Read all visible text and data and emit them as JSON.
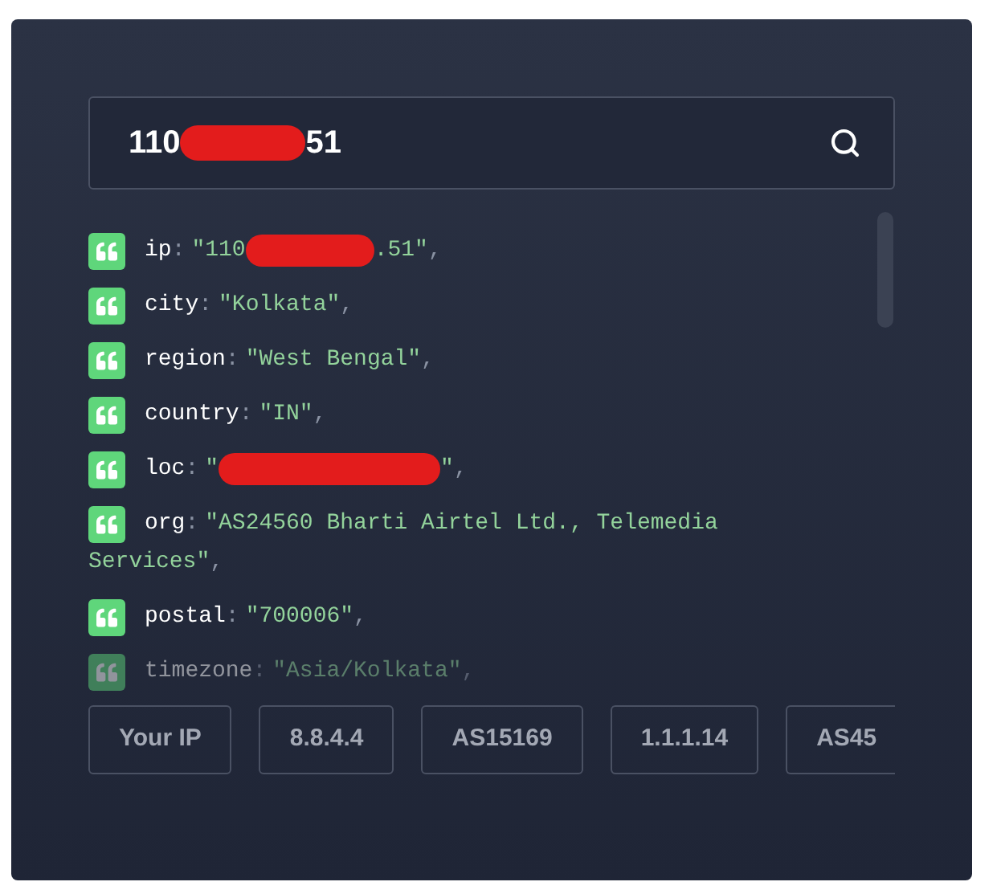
{
  "search": {
    "value_parts": [
      "110",
      "51"
    ]
  },
  "rows": [
    {
      "key": "ip",
      "sep": ":",
      "value_parts": [
        "\"110",
        ".51\""
      ],
      "trail": ",",
      "faded": false
    },
    {
      "key": "city",
      "sep": ":",
      "value_parts": [
        "\"Kolkata\""
      ],
      "trail": ",",
      "faded": false
    },
    {
      "key": "region",
      "sep": ":",
      "value_parts": [
        "\"West Bengal\""
      ],
      "trail": ",",
      "faded": false
    },
    {
      "key": "country",
      "sep": ":",
      "value_parts": [
        "\"IN\""
      ],
      "trail": ",",
      "faded": false
    },
    {
      "key": "loc",
      "sep": ":",
      "value_parts": [
        "\"",
        "\""
      ],
      "trail": ",",
      "faded": false
    },
    {
      "key": "org",
      "sep": ":",
      "value_parts": [
        "\"AS24560 Bharti Airtel Ltd., Telemedia"
      ],
      "continued": "Services\"",
      "trail": ",",
      "faded": false
    },
    {
      "key": "postal",
      "sep": ":",
      "value_parts": [
        "\"700006\""
      ],
      "trail": ",",
      "faded": false
    },
    {
      "key": "timezone",
      "sep": ":",
      "value_parts": [
        "\"Asia/Kolkata\""
      ],
      "trail": ",",
      "faded": true
    }
  ],
  "chips": [
    "Your IP",
    "8.8.4.4",
    "AS15169",
    "1.1.1.14",
    "AS45"
  ]
}
